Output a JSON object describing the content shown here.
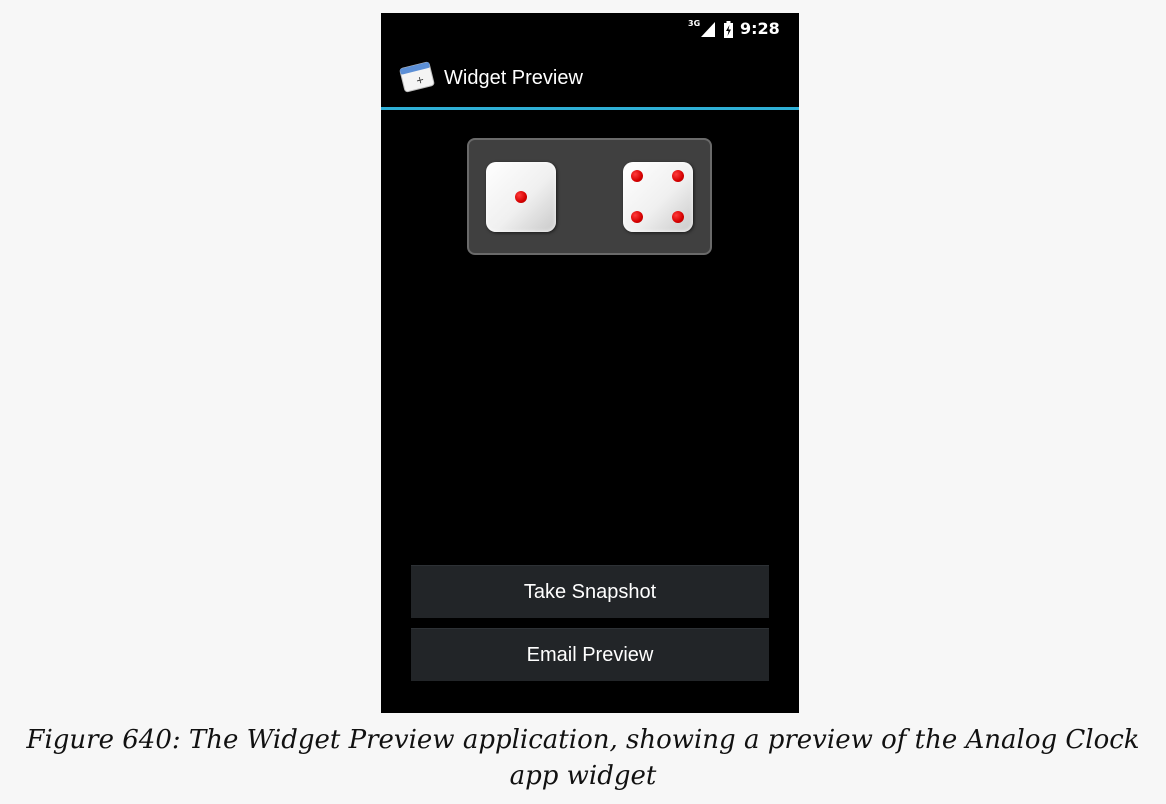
{
  "status_bar": {
    "network": "3G",
    "time": "9:28"
  },
  "action_bar": {
    "title": "Widget Preview",
    "accent_color": "#2fb0d6"
  },
  "widget": {
    "dice": [
      {
        "name": "die-one",
        "value": 1
      },
      {
        "name": "die-four",
        "value": 4
      }
    ],
    "pip_color": "#d50000"
  },
  "buttons": {
    "take_snapshot": "Take Snapshot",
    "email_preview": "Email Preview"
  },
  "caption": {
    "line1": "Figure 640: The Widget Preview application, showing a preview of the Analog Clock",
    "line2": "app widget"
  }
}
